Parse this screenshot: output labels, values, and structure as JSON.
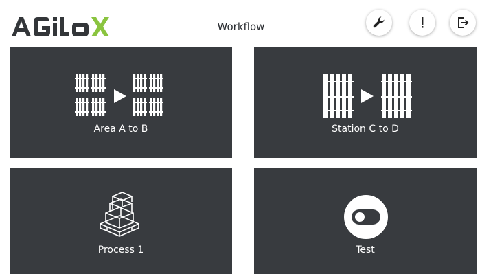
{
  "header": {
    "logo_text": "AGILOX",
    "title": "Workflow",
    "buttons": [
      {
        "icon": "wrench-icon"
      },
      {
        "icon": "exclamation-icon"
      },
      {
        "icon": "logout-icon"
      }
    ]
  },
  "colors": {
    "tile_bg": "#383b3f",
    "logo_dark": "#333639",
    "logo_green": "#8ac43f",
    "text_white": "#ffffff"
  },
  "tiles": [
    {
      "label": "Area A to B",
      "icon": "pallets-to-pallets-icon"
    },
    {
      "label": "Station C to D",
      "icon": "racks-to-racks-icon"
    },
    {
      "label": "Process 1",
      "icon": "boxes-on-pallet-icon"
    },
    {
      "label": "Test",
      "icon": "toggle-icon"
    }
  ]
}
